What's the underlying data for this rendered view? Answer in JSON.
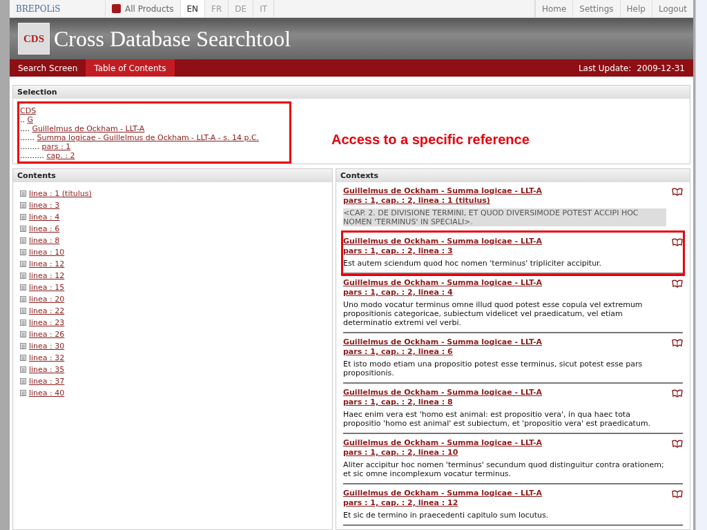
{
  "topbar": {
    "brand": "BREPOLiS",
    "products": "All Products",
    "languages": [
      {
        "label": "EN",
        "selected": true
      },
      {
        "label": "FR",
        "selected": false
      },
      {
        "label": "DE",
        "selected": false
      },
      {
        "label": "IT",
        "selected": false
      }
    ],
    "links": [
      "Home",
      "Settings",
      "Help",
      "Logout"
    ]
  },
  "banner": {
    "logo": "CDS",
    "title": "Cross Database Searchtool"
  },
  "nav": {
    "tabs": [
      {
        "label": "Search Screen",
        "selected": false
      },
      {
        "label": "Table of Contents",
        "selected": true
      }
    ],
    "last_update_label": "Last Update:",
    "last_update": "2009-12-31"
  },
  "selection": {
    "title": "Selection",
    "highlighted": true,
    "annotation": "Access to a specific reference",
    "tree": [
      {
        "label": "CDS",
        "children": [
          {
            "prefix": "..",
            "label": "G",
            "children": [
              {
                "prefix": "....",
                "label": "Guillelmus de Ockham - LLT-A",
                "children": [
                  {
                    "prefix": "......",
                    "label": "Summa logicae - Guillelmus de Ockham - LLT-A - s. 14 p.C.",
                    "children": [
                      {
                        "prefix": "........",
                        "label": "pars : 1",
                        "children": [
                          {
                            "prefix": "..........",
                            "label": "cap. : 2"
                          }
                        ]
                      }
                    ]
                  }
                ]
              }
            ]
          }
        ]
      }
    ]
  },
  "contents": {
    "title": "Contents",
    "items": [
      "linea : 1 (titulus)",
      "linea : 3",
      "linea : 4",
      "linea : 6",
      "linea : 8",
      "linea : 10",
      "linea : 12",
      "linea : 12",
      "linea : 15",
      "linea : 20",
      "linea : 22",
      "linea : 23",
      "linea : 26",
      "linea : 30",
      "linea : 32",
      "linea : 35",
      "linea : 37",
      "linea : 40"
    ]
  },
  "contexts": {
    "title": "Contexts",
    "items": [
      {
        "work": "Guillelmus de Ockham - Summa logicae - LLT-A",
        "ref": "pars : 1, cap. : 2, linea : 1 (titulus)",
        "text": "<CAP. 2. DE DIVISIONE TERMINI, ET QUOD DIVERSIMODE POTEST ACCIPI HOC NOMEN 'TERMINUS' IN SPECIALI>.",
        "shaded": true,
        "highlighted": false
      },
      {
        "work": "Guillelmus de Ockham - Summa logicae - LLT-A",
        "ref": "pars : 1, cap. : 2, linea : 3",
        "text": "Est autem sciendum quod hoc nomen 'terminus' tripliciter accipitur.",
        "shaded": false,
        "highlighted": true
      },
      {
        "work": "Guillelmus de Ockham - Summa logicae - LLT-A",
        "ref": "pars : 1, cap. : 2, linea : 4",
        "text": "Uno modo vocatur terminus omne illud quod potest esse copula vel extremum propositionis categoricae, subiectum videlicet vel praedicatum, vel etiam determinatio extremi vel verbi.",
        "shaded": false,
        "highlighted": false
      },
      {
        "work": "Guillelmus de Ockham - Summa logicae - LLT-A",
        "ref": "pars : 1, cap. : 2, linea : 6",
        "text": "Et isto modo etiam una propositio potest esse terminus, sicut potest esse pars propositionis.",
        "shaded": false,
        "highlighted": false
      },
      {
        "work": "Guillelmus de Ockham - Summa logicae - LLT-A",
        "ref": "pars : 1, cap. : 2, linea : 8",
        "text": "Haec enim vera est 'homo est animal: est propositio vera', in qua haec tota propositio 'homo est animal' est subiectum, et 'propositio vera' est praedicatum.",
        "shaded": false,
        "highlighted": false
      },
      {
        "work": "Guillelmus de Ockham - Summa logicae - LLT-A",
        "ref": "pars : 1, cap. : 2, linea : 10",
        "text": "Aliter accipitur hoc nomen 'terminus' secundum quod distinguitur contra orationem; et sic omne incomplexum vocatur terminus.",
        "shaded": false,
        "highlighted": false
      },
      {
        "work": "Guillelmus de Ockham - Summa logicae - LLT-A",
        "ref": "pars : 1, cap. : 2, linea : 12",
        "text": "Et sic de termino in praecedenti capitulo sum locutus.",
        "shaded": false,
        "highlighted": false
      }
    ]
  }
}
